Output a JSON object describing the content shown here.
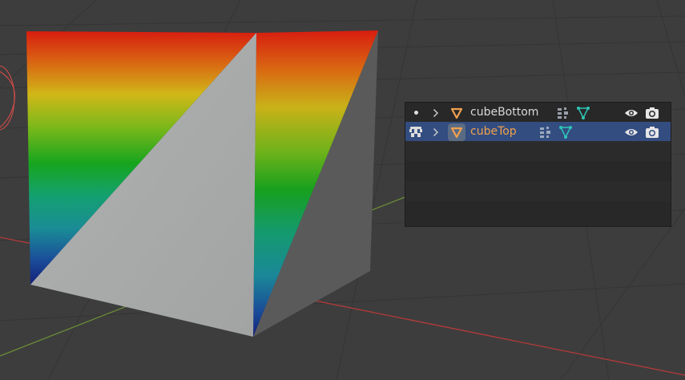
{
  "viewport": {
    "grid_color": "#353535",
    "x_axis_color": "#b63a3a",
    "y_axis_color": "#6a8a36"
  },
  "outliner": {
    "rows": [
      {
        "name": "cubeBottom",
        "selected": false,
        "object_icon": "mesh-object-icon",
        "data_icon": "mesh-data-icon",
        "modifier_icon": "vertex-groups-icon"
      },
      {
        "name": "cubeTop",
        "selected": true,
        "object_icon": "mesh-object-icon",
        "data_icon": "mesh-data-icon",
        "modifier_icon": "vertex-groups-icon"
      }
    ],
    "accent_color": "#f2a24a",
    "selected_color": "#334d80"
  }
}
